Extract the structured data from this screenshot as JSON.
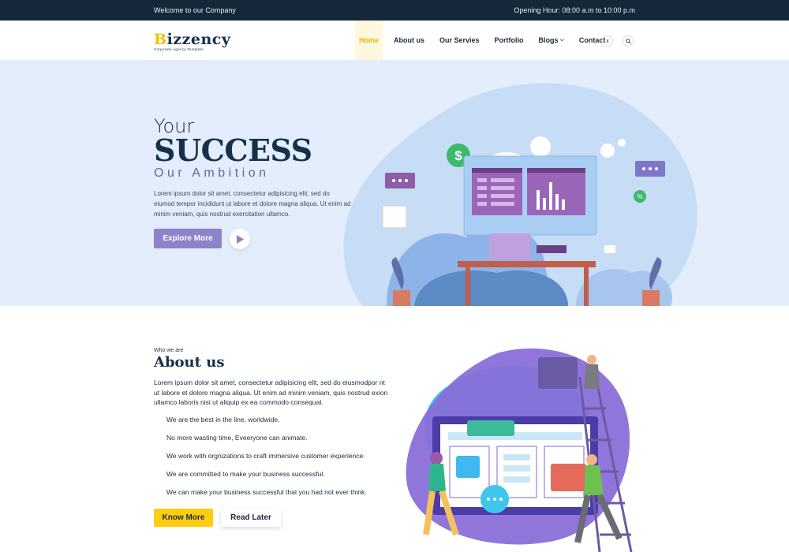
{
  "topbar": {
    "welcome": "Welcome to our Company",
    "hours": "Opening Hour: 08:00 a.m to 10:00 p.m"
  },
  "brand": {
    "name_accent": "B",
    "name_rest": "izzency",
    "tagline": "Corporate Agency Template"
  },
  "nav": {
    "items": [
      {
        "label": "Home",
        "active": true
      },
      {
        "label": "About us"
      },
      {
        "label": "Our Servies"
      },
      {
        "label": "Portfolio"
      },
      {
        "label": "Blogs",
        "has_dropdown": true
      },
      {
        "label": "Contact"
      }
    ],
    "close_icon": "x-icon",
    "search_icon": "search-icon"
  },
  "hero": {
    "line1": "Your",
    "line2": "SUCCESS",
    "line3": "Our Ambition",
    "description": "Lorem ipsum dolor sit amet, consectetur adipisicing elit, sed do eiumod tempor incididunt ut labore et dolore magna aliqua. Ut enim ad minim veniam, quis nostrud exercitation ullamco.",
    "cta_label": "Explore More",
    "play_icon": "play-icon",
    "illustration_dollar": "$",
    "illustration_percent": "%"
  },
  "about": {
    "eyebrow": "Who we are",
    "title": "About us",
    "description": "Lorem ipsum dolor sit amet, consectetur adipisicing elit, sed do eiusmodpor nt ut labore et dolore magna aliqua. Ut enim ad minim veniam, quis nostrud exion ullamco laboris nisi ut aliquip ex ea commodo consequat.",
    "features": [
      "We are the best in the line, worldwide.",
      "No more wasting time, Eveeryone can animate.",
      "We work with orgnizations to craft immersive customer experience.",
      "We are committed to make your business successful.",
      "We can make your business successful that you had not ever think."
    ],
    "primary_button": "Know More",
    "secondary_button": "Read Later"
  },
  "colors": {
    "topbar_bg": "#14283a",
    "accent_yellow": "#ffcc10",
    "hero_bg": "#e4edfb",
    "button_purple": "#8c83c9"
  }
}
